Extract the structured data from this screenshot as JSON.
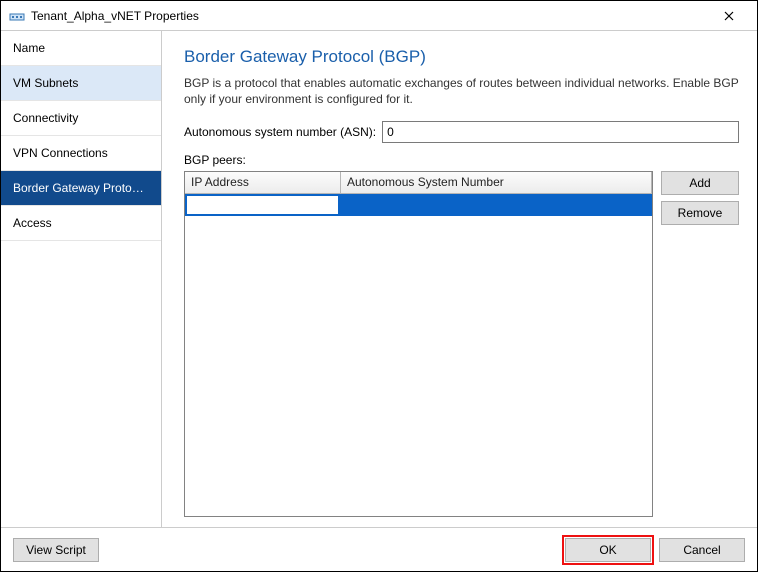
{
  "window": {
    "title": "Tenant_Alpha_vNET Properties"
  },
  "sidebar": {
    "header": "Name",
    "items": [
      {
        "label": "VM Subnets"
      },
      {
        "label": "Connectivity"
      },
      {
        "label": "VPN Connections"
      },
      {
        "label": "Border Gateway Protocol..."
      },
      {
        "label": "Access"
      }
    ]
  },
  "content": {
    "heading": "Border Gateway Protocol (BGP)",
    "description": "BGP is a protocol that enables automatic exchanges of routes between individual networks. Enable BGP only if your environment is configured for it.",
    "asn_label": "Autonomous system number (ASN):",
    "asn_value": "0",
    "peers_label": "BGP peers:",
    "grid": {
      "col_ip": "IP Address",
      "col_asn": "Autonomous System Number",
      "row0_ip": "",
      "row0_asn": ""
    },
    "buttons": {
      "add": "Add",
      "remove": "Remove"
    }
  },
  "footer": {
    "view_script": "View Script",
    "ok": "OK",
    "cancel": "Cancel"
  }
}
